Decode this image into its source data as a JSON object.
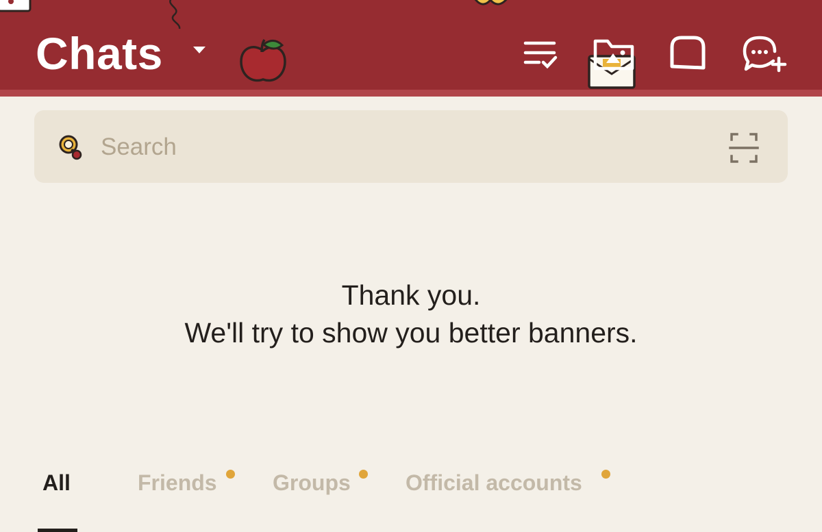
{
  "header": {
    "title": "Chats",
    "bg_color": "#962c31",
    "actions": [
      {
        "name": "edit-list",
        "icon": "list-check-icon"
      },
      {
        "name": "albums",
        "icon": "folder-image-icon"
      },
      {
        "name": "square-chat",
        "icon": "rounded-square-icon"
      },
      {
        "name": "new-chat",
        "icon": "chat-bubble-plus-icon"
      }
    ]
  },
  "search": {
    "placeholder": "Search",
    "left_icon": "search-magnifier-icon",
    "right_icon": "scan-icon"
  },
  "message": {
    "line1": "Thank you.",
    "line2": "We'll try to show you better banners."
  },
  "tabs": [
    {
      "label": "All",
      "active": true,
      "badge": false
    },
    {
      "label": "Friends",
      "active": false,
      "badge": true
    },
    {
      "label": "Groups",
      "active": false,
      "badge": true
    },
    {
      "label": "Official accounts",
      "active": false,
      "badge": true
    }
  ],
  "colors": {
    "accent": "#962c31",
    "background": "#f4f0e8",
    "badge": "#e0a53a"
  }
}
